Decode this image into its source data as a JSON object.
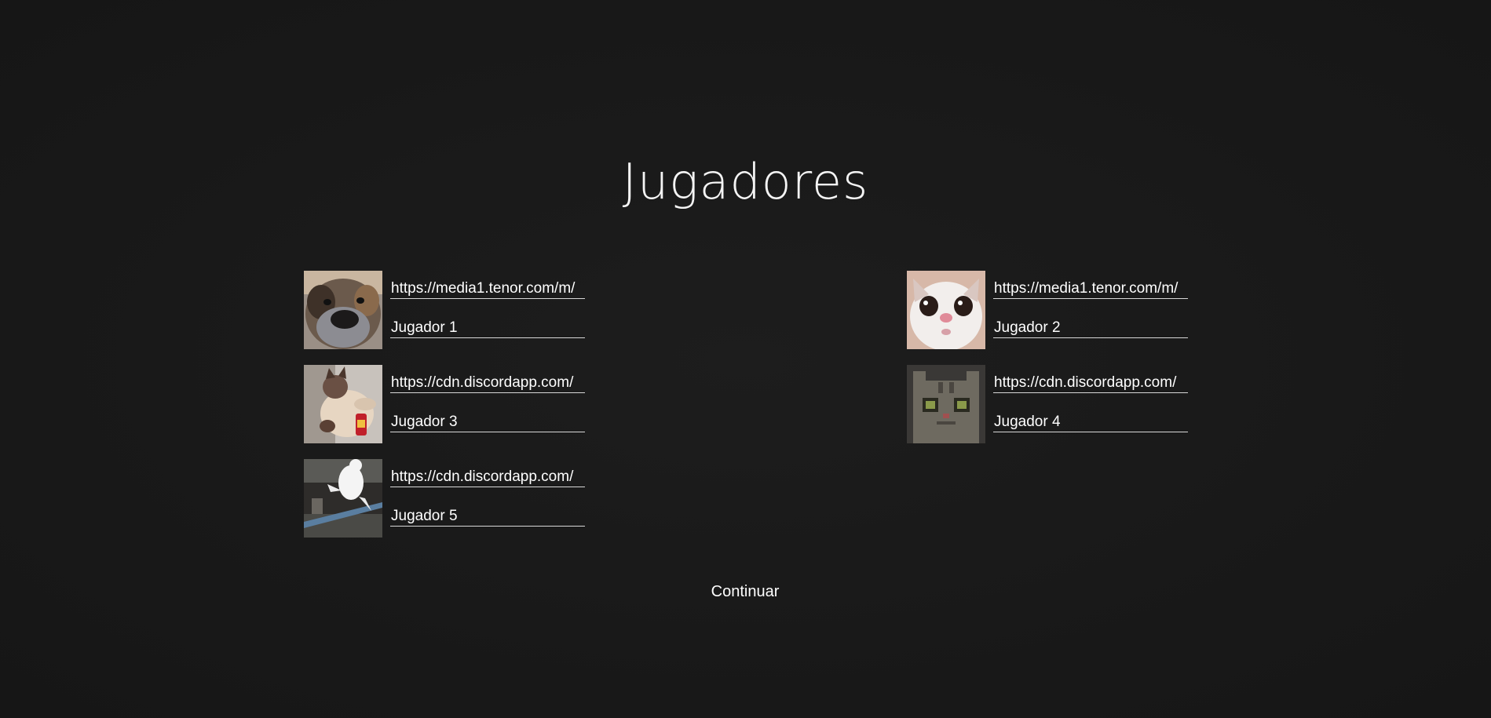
{
  "title": "Jugadores",
  "players": [
    {
      "url": "https://media1.tenor.com/m/",
      "name": "Jugador 1",
      "avatar": "dog-closeup-gif"
    },
    {
      "url": "https://media1.tenor.com/m/",
      "name": "Jugador 2",
      "avatar": "white-cat-face-gif"
    },
    {
      "url": "https://cdn.discordapp.com/",
      "name": "Jugador 3",
      "avatar": "siamese-cat-gif"
    },
    {
      "url": "https://cdn.discordapp.com/",
      "name": "Jugador 4",
      "avatar": "pixel-cat-gif"
    },
    {
      "url": "https://cdn.discordapp.com/",
      "name": "Jugador 5",
      "avatar": "white-cat-jumping-gif"
    }
  ],
  "continue_label": "Continuar",
  "colors": {
    "background": "#1a1a1a",
    "text": "#ffffff",
    "underline": "#d8d8d8"
  }
}
